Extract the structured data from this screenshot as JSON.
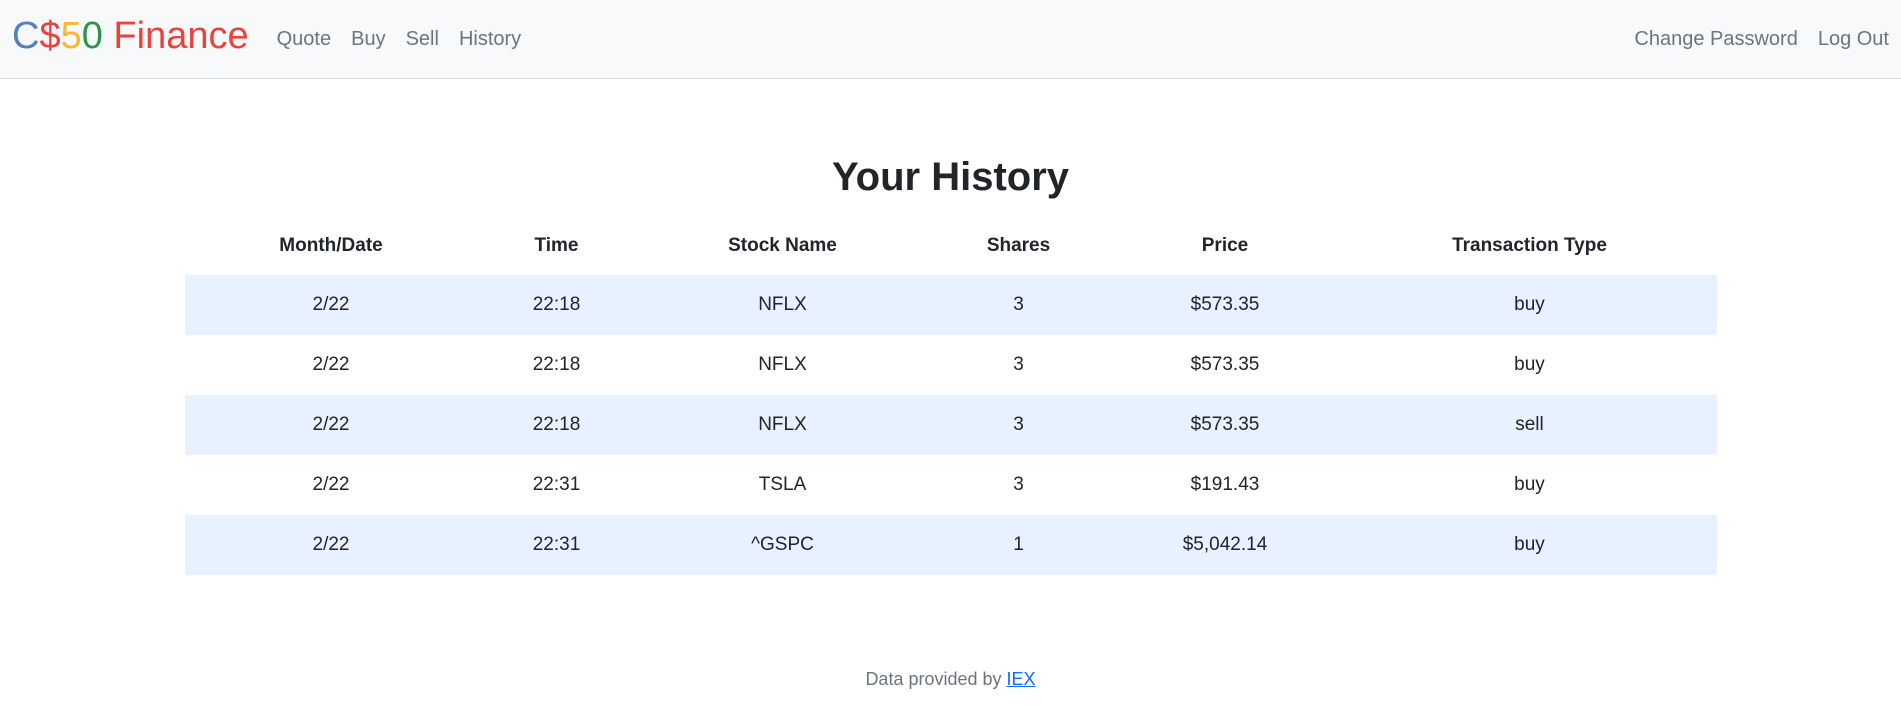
{
  "brand": {
    "parts": [
      {
        "text": "C",
        "color": "#537fbe"
      },
      {
        "text": "$",
        "color": "#ea433b"
      },
      {
        "text": "5",
        "color": "#f5b82e"
      },
      {
        "text": "0",
        "color": "#2e944b"
      },
      {
        "text": " Finance",
        "color": "#ea433b"
      }
    ]
  },
  "nav": {
    "left": [
      "Quote",
      "Buy",
      "Sell",
      "History"
    ],
    "right": [
      "Change Password",
      "Log Out"
    ]
  },
  "page": {
    "title": "Your History"
  },
  "table": {
    "headers": [
      "Month/Date",
      "Time",
      "Stock Name",
      "Shares",
      "Price",
      "Transaction Type"
    ],
    "rows": [
      [
        "2/22",
        "22:18",
        "NFLX",
        "3",
        "$573.35",
        "buy"
      ],
      [
        "2/22",
        "22:18",
        "NFLX",
        "3",
        "$573.35",
        "buy"
      ],
      [
        "2/22",
        "22:18",
        "NFLX",
        "3",
        "$573.35",
        "sell"
      ],
      [
        "2/22",
        "22:31",
        "TSLA",
        "3",
        "$191.43",
        "buy"
      ],
      [
        "2/22",
        "22:31",
        "^GSPC",
        "1",
        "$5,042.14",
        "buy"
      ]
    ]
  },
  "footer": {
    "prefix": "Data provided by ",
    "link_text": "IEX"
  },
  "colors": {
    "stripe": "#e7f1ff",
    "navbar_bg": "#f8f9fa",
    "link": "#0d6efd",
    "muted": "#6c757d"
  }
}
